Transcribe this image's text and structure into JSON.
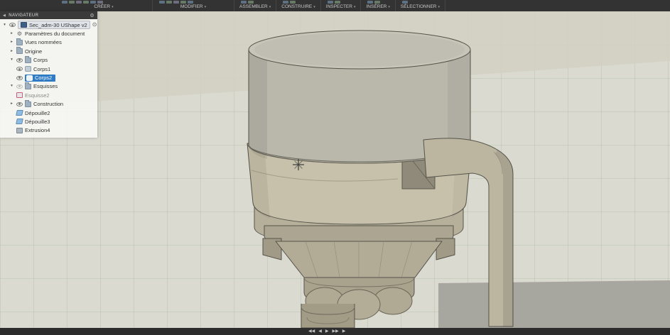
{
  "toolbar": {
    "groups": [
      {
        "label": "CRÉER"
      },
      {
        "label": "MODIFIER"
      },
      {
        "label": "ASSEMBLER"
      },
      {
        "label": "CONSTRUIRE"
      },
      {
        "label": "INSPECTER"
      },
      {
        "label": "INSÉRER"
      },
      {
        "label": "SÉLECTIONNER"
      }
    ]
  },
  "icons": {
    "caret": "▾",
    "collapsed": "▸",
    "expanded": "▾",
    "radio": "⊙",
    "gear": "⚙",
    "back": "◀"
  },
  "browser": {
    "title": "NAVIGATEUR",
    "items": [
      {
        "label": "Sec_adm-30 UShape v2",
        "type": "document"
      },
      {
        "label": "Paramètres du document",
        "type": "settings"
      },
      {
        "label": "Vues nommées",
        "type": "folder"
      },
      {
        "label": "Origine",
        "type": "folder"
      },
      {
        "label": "Corps",
        "type": "folder"
      },
      {
        "label": "Corps1",
        "type": "body"
      },
      {
        "label": "Corps2",
        "type": "body",
        "selected": true
      },
      {
        "label": "Esquisses",
        "type": "folder"
      },
      {
        "label": "Esquisse2",
        "type": "sketch"
      },
      {
        "label": "Construction",
        "type": "folder"
      },
      {
        "label": "Dépouille2",
        "type": "feature"
      },
      {
        "label": "Dépouille3",
        "type": "feature"
      },
      {
        "label": "Extrusion4",
        "type": "feature"
      }
    ]
  },
  "timeline": {
    "controls": [
      "◀◀",
      "◀",
      "▶",
      "▶▶",
      "▶"
    ]
  },
  "colors": {
    "selection_blue": "#2f7bc4",
    "toolbar_bg": "#333333",
    "viewport_bg": "#dbdad1",
    "grid_green": "#78a078",
    "model_tan": "#c7c1ab",
    "model_gray": "#bab7ab",
    "ground_band": "#a7a69f"
  }
}
